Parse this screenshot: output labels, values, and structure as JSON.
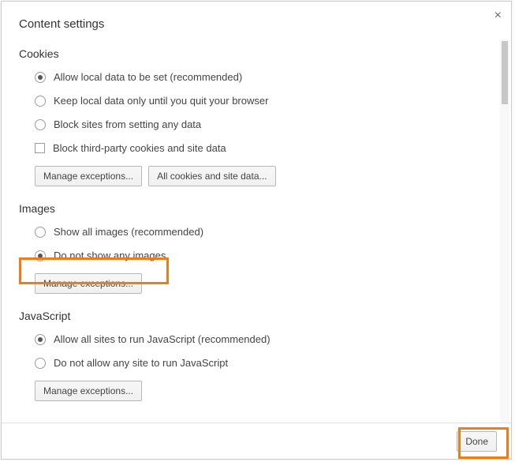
{
  "dialog": {
    "title": "Content settings"
  },
  "sections": {
    "cookies": {
      "title": "Cookies",
      "options": [
        "Allow local data to be set (recommended)",
        "Keep local data only until you quit your browser",
        "Block sites from setting any data"
      ],
      "checkbox": "Block third-party cookies and site data",
      "buttons": {
        "manage": "Manage exceptions...",
        "all": "All cookies and site data..."
      }
    },
    "images": {
      "title": "Images",
      "options": [
        "Show all images (recommended)",
        "Do not show any images"
      ],
      "buttons": {
        "manage": "Manage exceptions..."
      }
    },
    "javascript": {
      "title": "JavaScript",
      "options": [
        "Allow all sites to run JavaScript (recommended)",
        "Do not allow any site to run JavaScript"
      ],
      "buttons": {
        "manage": "Manage exceptions..."
      }
    }
  },
  "footer": {
    "done": "Done"
  }
}
